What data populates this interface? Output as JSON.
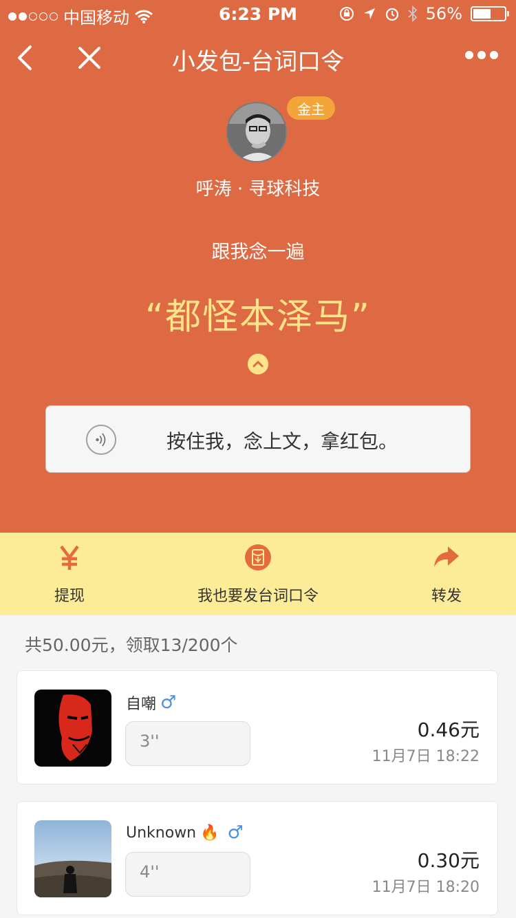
{
  "status_bar": {
    "carrier": "中国移动",
    "time": "6:23 PM",
    "battery": "56%",
    "battery_level": 0.56
  },
  "nav": {
    "title": "小发包-台词口令",
    "back_icon": "chevron-left-icon",
    "close_icon": "close-icon",
    "more_icon": "more-dots-icon"
  },
  "host": {
    "badge": "金主",
    "name": "呼涛 · 寻球科技"
  },
  "challenge": {
    "intro": "跟我念一遍",
    "phrase": "“都怪本泽马”",
    "record_label": "按住我，念上文，拿红包。"
  },
  "actions": [
    {
      "label": "提现",
      "icon": "yen-icon"
    },
    {
      "label": "我也要发台词口令",
      "icon": "red-packet-icon"
    },
    {
      "label": "转发",
      "icon": "share-arrow-icon"
    }
  ],
  "summary": "共50.00元，领取13/200个",
  "entries": [
    {
      "name": "自嘲",
      "gender": "♂",
      "duration": "3''",
      "amount": "0.46元",
      "time": "11月7日 18:22"
    },
    {
      "name": "Unknown",
      "emoji": "🔥",
      "gender": "♂",
      "duration": "4''",
      "amount": "0.30元",
      "time": "11月7日 18:20"
    }
  ],
  "colors": {
    "primary": "#de6a43",
    "phrase": "#ffe38a",
    "action_bar": "#fcec97",
    "badge": "#f3a53a",
    "male": "#4a90e2"
  }
}
